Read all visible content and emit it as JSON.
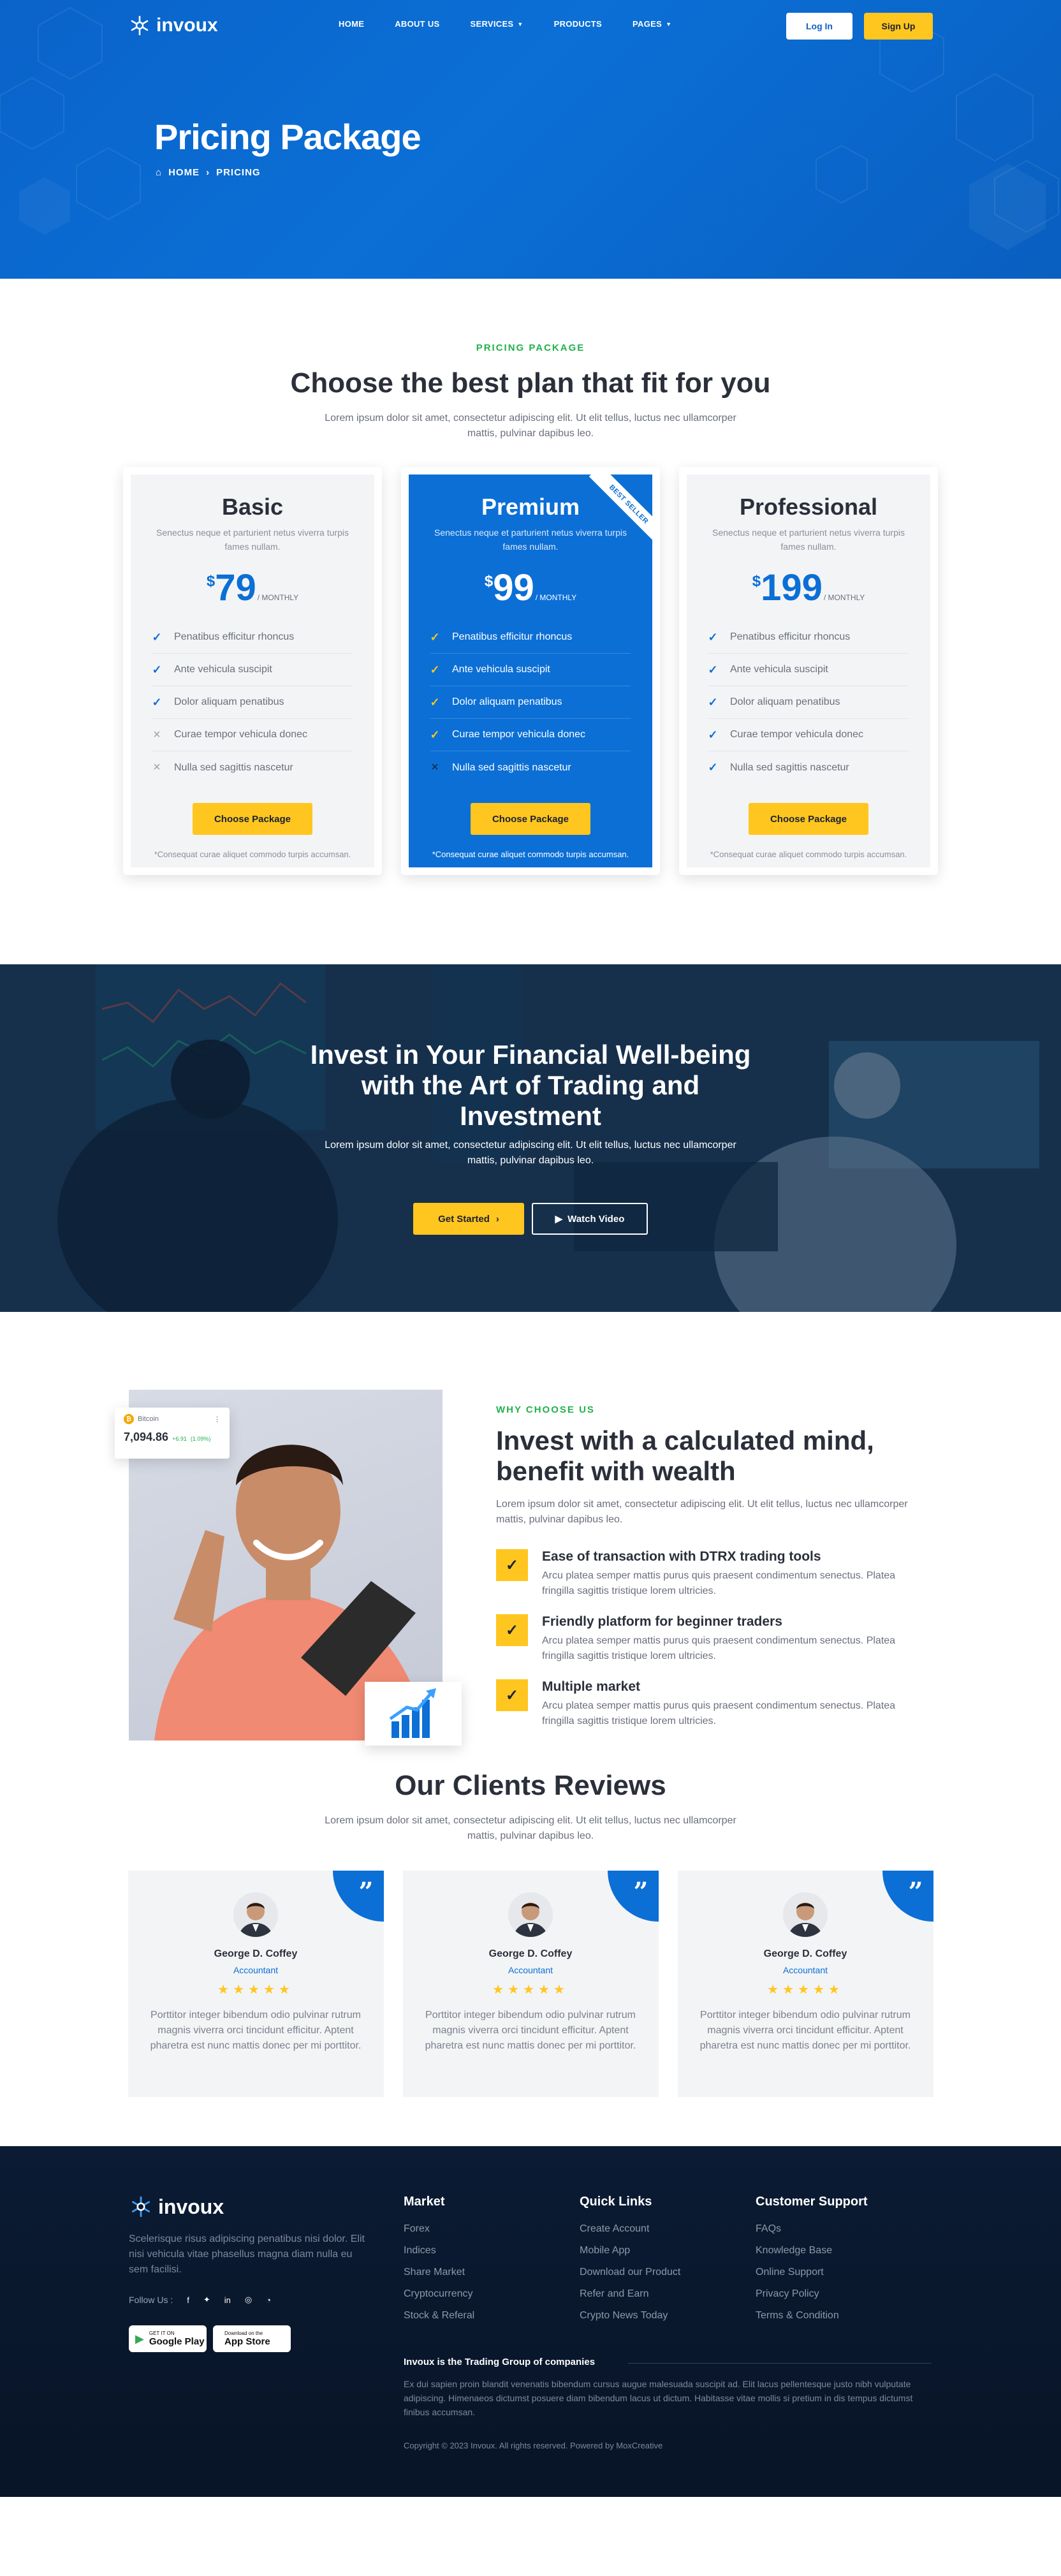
{
  "brand": {
    "name": "invoux"
  },
  "nav": {
    "items": [
      {
        "label": "HOME",
        "caret": false
      },
      {
        "label": "ABOUT US",
        "caret": false
      },
      {
        "label": "SERVICES",
        "caret": true
      },
      {
        "label": "PRODUCTS",
        "caret": false
      },
      {
        "label": "PAGES",
        "caret": true
      }
    ],
    "login": "Log In",
    "signup": "Sign Up"
  },
  "hero": {
    "title": "Pricing Package",
    "breadcrumb": [
      "HOME",
      "PRICING"
    ]
  },
  "pricing": {
    "eyebrow": "PRICING PACKAGE",
    "title": "Choose the best plan that fit for you",
    "subtitle": "Lorem ipsum dolor sit amet, consectetur adipiscing elit. Ut elit tellus, luctus nec ullamcorper mattis, pulvinar dapibus leo.",
    "plans": [
      {
        "name": "Basic",
        "desc": "Senectus neque et parturient netus viverra turpis fames nullam.",
        "currency": "$",
        "price": "79",
        "period": "/ MONTHLY",
        "features": [
          {
            "text": "Penatibus efficitur rhoncus",
            "included": true
          },
          {
            "text": "Ante vehicula suscipit",
            "included": true
          },
          {
            "text": "Dolor aliquam penatibus",
            "included": true
          },
          {
            "text": "Curae tempor vehicula donec",
            "included": false
          },
          {
            "text": "Nulla sed sagittis nascetur",
            "included": false
          }
        ],
        "button": "Choose Package",
        "note": "*Consequat curae aliquet commodo turpis accumsan."
      },
      {
        "name": "Premium",
        "desc": "Senectus neque et parturient netus viverra turpis fames nullam.",
        "currency": "$",
        "price": "99",
        "period": "/ MONTHLY",
        "ribbon": "BEST SELLER",
        "features": [
          {
            "text": "Penatibus efficitur rhoncus",
            "included": true
          },
          {
            "text": "Ante vehicula suscipit",
            "included": true
          },
          {
            "text": "Dolor aliquam penatibus",
            "included": true
          },
          {
            "text": "Curae tempor vehicula donec",
            "included": true
          },
          {
            "text": "Nulla sed sagittis nascetur",
            "included": false
          }
        ],
        "button": "Choose Package",
        "note": "*Consequat curae aliquet commodo turpis accumsan."
      },
      {
        "name": "Professional",
        "desc": "Senectus neque et parturient netus viverra turpis fames nullam.",
        "currency": "$",
        "price": "199",
        "period": "/ MONTHLY",
        "features": [
          {
            "text": "Penatibus efficitur rhoncus",
            "included": true
          },
          {
            "text": "Ante vehicula suscipit",
            "included": true
          },
          {
            "text": "Dolor aliquam penatibus",
            "included": true
          },
          {
            "text": "Curae tempor vehicula donec",
            "included": true
          },
          {
            "text": "Nulla sed sagittis nascetur",
            "included": true
          }
        ],
        "button": "Choose Package",
        "note": "*Consequat curae aliquet commodo turpis accumsan."
      }
    ]
  },
  "banner": {
    "title": "Invest in Your Financial Well-being with the Art of Trading and Investment",
    "subtitle": "Lorem ipsum dolor sit amet, consectetur adipiscing elit. Ut elit tellus, luctus nec ullamcorper mattis, pulvinar dapibus leo.",
    "primary": "Get Started",
    "secondary": "Watch Video"
  },
  "why": {
    "eyebrow": "WHY CHOOSE US",
    "title": "Invest with a calculated mind, benefit with wealth",
    "subtitle": "Lorem ipsum dolor sit amet, consectetur adipiscing elit. Ut elit tellus, luctus nec ullamcorper mattis, pulvinar dapibus leo.",
    "ticker": {
      "coin": "Bitcoin",
      "value": "7,094.86",
      "change": "+6.91",
      "pct": "(1.09%)"
    },
    "items": [
      {
        "title": "Ease of transaction with DTRX trading tools",
        "text": "Arcu platea semper mattis purus quis praesent condimentum senectus. Platea fringilla sagittis tristique lorem ultricies."
      },
      {
        "title": "Friendly platform for beginner traders",
        "text": "Arcu platea semper mattis purus quis praesent condimentum senectus. Platea fringilla sagittis tristique lorem ultricies."
      },
      {
        "title": "Multiple market",
        "text": "Arcu platea semper mattis purus quis praesent condimentum senectus. Platea fringilla sagittis tristique lorem ultricies."
      }
    ]
  },
  "reviews": {
    "title": "Our Clients Reviews",
    "subtitle": "Lorem ipsum dolor sit amet, consectetur adipiscing elit. Ut elit tellus, luctus nec ullamcorper mattis, pulvinar dapibus leo.",
    "items": [
      {
        "name": "George D. Coffey",
        "role": "Accountant",
        "stars": "★★★★★",
        "text": "Porttitor integer bibendum odio pulvinar rutrum magnis viverra orci tincidunt efficitur. Aptent pharetra est nunc mattis donec per mi porttitor."
      },
      {
        "name": "George D. Coffey",
        "role": "Accountant",
        "stars": "★★★★★",
        "text": "Porttitor integer bibendum odio pulvinar rutrum magnis viverra orci tincidunt efficitur. Aptent pharetra est nunc mattis donec per mi porttitor."
      },
      {
        "name": "George D. Coffey",
        "role": "Accountant",
        "stars": "★★★★★",
        "text": "Porttitor integer bibendum odio pulvinar rutrum magnis viverra orci tincidunt efficitur. Aptent pharetra est nunc mattis donec per mi porttitor."
      }
    ]
  },
  "footer": {
    "desc": "Scelerisque risus adipiscing penatibus nisi dolor. Elit nisi vehicula vitae phasellus magna diam nulla eu sem facilisi.",
    "follow": "Follow Us :",
    "stores": [
      {
        "small": "GET IT ON",
        "big": "Google Play"
      },
      {
        "small": "Download on the",
        "big": "App Store"
      }
    ],
    "columns": [
      {
        "title": "Market",
        "links": [
          "Forex",
          "Indices",
          "Share Market",
          "Cryptocurrency",
          "Stock & Referal"
        ]
      },
      {
        "title": "Quick Links",
        "links": [
          "Create Account",
          "Mobile App",
          "Download our Product",
          "Refer and Earn",
          "Crypto News Today"
        ]
      },
      {
        "title": "Customer Support",
        "links": [
          "FAQs",
          "Knowledge Base",
          "Online Support",
          "Privacy Policy",
          "Terms & Condition"
        ]
      }
    ],
    "group_title": "Invoux is the Trading Group of companies",
    "group_desc": "Ex dui sapien proin blandit venenatis bibendum cursus augue malesuada suscipit ad. Elit lacus pellentesque justo nibh vulputate adipiscing. Himenaeos dictumst posuere diam bibendum lacus ut dictum. Habitasse vitae mollis si pretium in dis tempus dictumst finibus accumsan.",
    "copyright": "Copyright © 2023 Invoux. All rights reserved. Powered by MoxCreative"
  },
  "colors": {
    "primary": "#0b6fd6",
    "accent": "#ffc61f",
    "green": "#22b14c",
    "footer": "#0b1b33"
  }
}
